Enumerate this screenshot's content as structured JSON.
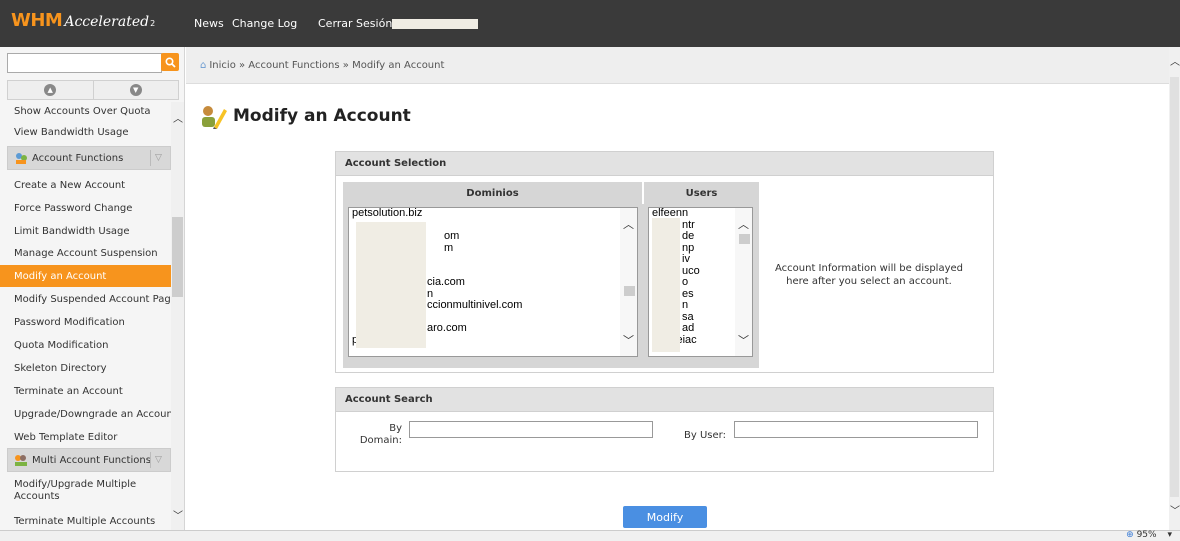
{
  "topbar": {
    "logo": {
      "whm": "WHM",
      "accelerated": "Accelerated",
      "sub": "2"
    },
    "nav": {
      "news": "News",
      "changelog": "Change Log",
      "logout": "Cerrar Sesión"
    }
  },
  "breadcrumb": {
    "text": "Inicio » Account Functions » Modify an Account"
  },
  "sidebar": {
    "top_items": [
      "Show Accounts Over Quota",
      "View Bandwidth Usage"
    ],
    "section_account_functions": "Account Functions",
    "account_items": [
      "Create a New Account",
      "Force Password Change",
      "Limit Bandwidth Usage",
      "Manage Account Suspension",
      "Modify an Account",
      "Modify Suspended Account Page",
      "Password Modification",
      "Quota Modification",
      "Skeleton Directory",
      "Terminate an Account",
      "Upgrade/Downgrade an Account",
      "Web Template Editor"
    ],
    "section_multi": "Multi Account Functions",
    "multi_items": [
      "Modify/Upgrade Multiple Accounts",
      "Terminate Multiple Accounts"
    ]
  },
  "page": {
    "title": "Modify an Account"
  },
  "selection": {
    "header": "Account Selection",
    "col_domains": "Dominios",
    "col_users": "Users",
    "domains": [
      "petsolution.biz",
      "",
      "om",
      "m",
      "",
      "",
      "cia.com",
      "n",
      "ccionmultinivel.com",
      "",
      "aro.com",
      "planetaiso.pe"
    ],
    "users": [
      "elfeenn",
      "ntr",
      "de",
      "np",
      "iv",
      "uco",
      "o",
      "es",
      "n",
      "sa",
      "ad",
      "cliniceiac"
    ],
    "info": "Account Information will be displayed here after you select an account."
  },
  "search": {
    "header": "Account Search",
    "by_domain": "By Domain:",
    "by_user": "By User:",
    "domain_value": "",
    "user_value": ""
  },
  "buttons": {
    "modify": "Modify"
  },
  "status": {
    "zoom": "95%"
  },
  "colors": {
    "accent": "#f7941d",
    "topbar": "#3a3a3a",
    "button": "#4a8fe2"
  }
}
